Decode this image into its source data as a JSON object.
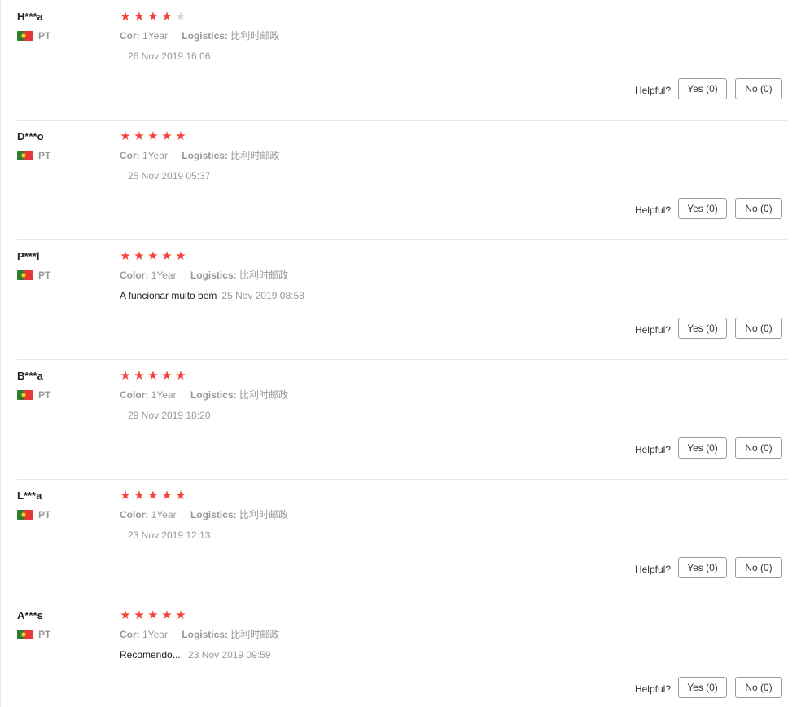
{
  "colors": {
    "star_on": "#f44336",
    "star_off": "#d9d9d9",
    "muted_text": "#999999",
    "divider": "#e6e6e6"
  },
  "labels": {
    "helpful": "Helpful?"
  },
  "reviews": [
    {
      "user": "H***a",
      "country": "PT",
      "flag_icon": "portugal-flag-icon",
      "rating": 4,
      "attr1_key": "Cor:",
      "attr1_val": "1Year",
      "attr2_key": "Logistics:",
      "attr2_val": "比利时邮政",
      "text": "",
      "date": "26 Nov 2019 16:06",
      "yes": "Yes (0)",
      "no": "No (0)"
    },
    {
      "user": "D***o",
      "country": "PT",
      "flag_icon": "portugal-flag-icon",
      "rating": 5,
      "attr1_key": "Cor:",
      "attr1_val": "1Year",
      "attr2_key": "Logistics:",
      "attr2_val": "比利时邮政",
      "text": "",
      "date": "25 Nov 2019 05:37",
      "yes": "Yes (0)",
      "no": "No (0)"
    },
    {
      "user": "P***l",
      "country": "PT",
      "flag_icon": "portugal-flag-icon",
      "rating": 5,
      "attr1_key": "Color:",
      "attr1_val": "1Year",
      "attr2_key": "Logistics:",
      "attr2_val": "比利时邮政",
      "text": "A funcionar muito bem",
      "date": "25 Nov 2019 08:58",
      "yes": "Yes (0)",
      "no": "No (0)"
    },
    {
      "user": "B***a",
      "country": "PT",
      "flag_icon": "portugal-flag-icon",
      "rating": 5,
      "attr1_key": "Color:",
      "attr1_val": "1Year",
      "attr2_key": "Logistics:",
      "attr2_val": "比利时邮政",
      "text": "",
      "date": "29 Nov 2019 18:20",
      "yes": "Yes (0)",
      "no": "No (0)"
    },
    {
      "user": "L***a",
      "country": "PT",
      "flag_icon": "portugal-flag-icon",
      "rating": 5,
      "attr1_key": "Color:",
      "attr1_val": "1Year",
      "attr2_key": "Logistics:",
      "attr2_val": "比利时邮政",
      "text": "",
      "date": "23 Nov 2019 12:13",
      "yes": "Yes (0)",
      "no": "No (0)"
    },
    {
      "user": "A***s",
      "country": "PT",
      "flag_icon": "portugal-flag-icon",
      "rating": 5,
      "attr1_key": "Cor:",
      "attr1_val": "1Year",
      "attr2_key": "Logistics:",
      "attr2_val": "比利时邮政",
      "text": "Recomendo....",
      "date": "23 Nov 2019 09:59",
      "yes": "Yes (0)",
      "no": "No (0)"
    }
  ]
}
